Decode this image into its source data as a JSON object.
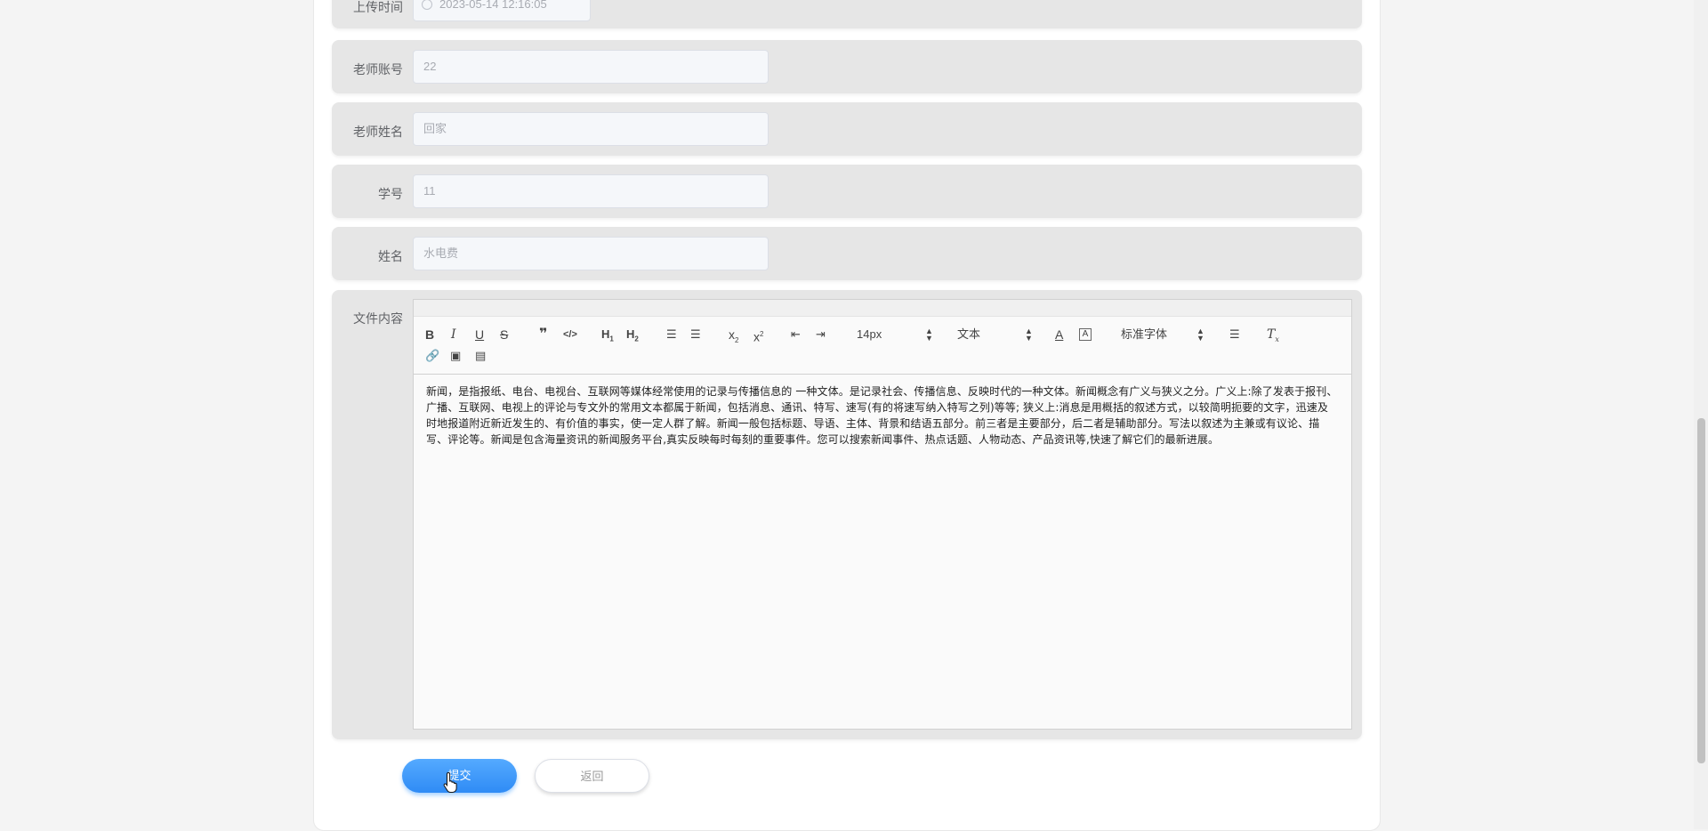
{
  "form": {
    "upload_time": {
      "label": "上传时间",
      "value": "2023-05-14 12:16:05"
    },
    "teacher_account": {
      "label": "老师账号",
      "value": "22"
    },
    "teacher_name": {
      "label": "老师姓名",
      "value": "回家"
    },
    "student_id": {
      "label": "学号",
      "value": "11"
    },
    "name": {
      "label": "姓名",
      "value": "水电费"
    },
    "file_content": {
      "label": "文件内容"
    }
  },
  "editor": {
    "toolbar": {
      "font_size": "14px",
      "header": "文本",
      "font_family": "标准字体"
    },
    "content": "新闻，是指报纸、电台、电视台、互联网等媒体经常使用的记录与传播信息的 一种文体。是记录社会、传播信息、反映时代的一种文体。新闻概念有广义与狭义之分。广义上:除了发表于报刊、广播、互联网、电视上的评论与专文外的常用文本都属于新闻，包括消息、通讯、特写、速写(有的将速写纳入特写之列)等等; 狭义上:消息是用概括的叙述方式，以较简明扼要的文字，迅速及时地报道附近新近发生的、有价值的事实，使一定人群了解。新闻一般包括标题、导语、主体、背景和结语五部分。前三者是主要部分，后二者是辅助部分。写法以叙述为主兼或有议论、描写、评论等。新闻是包含海量资讯的新闻服务平台,真实反映每时每刻的重要事件。您可以搜索新闻事件、热点话题、人物动态、产品资讯等,快速了解它们的最新进展。"
  },
  "buttons": {
    "submit": "提交",
    "back": "返回"
  }
}
